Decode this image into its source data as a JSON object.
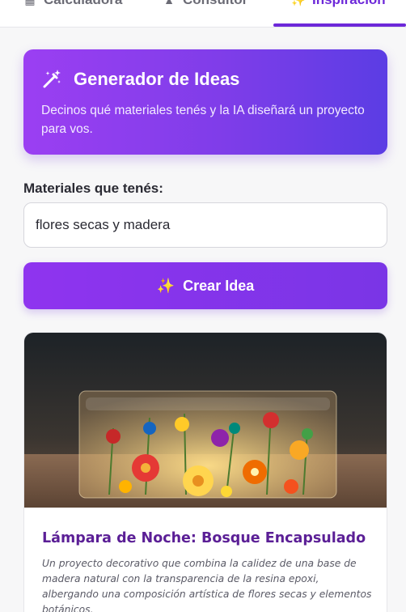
{
  "tabs": [
    {
      "label": "Calculadora",
      "icon": "calculator-icon"
    },
    {
      "label": "Consultor",
      "icon": "flask-icon"
    },
    {
      "label": "Inspiración",
      "icon": "sparkles-icon",
      "active": true
    }
  ],
  "hero": {
    "title": "Generador de Ideas",
    "description": "Decinos qué materiales tenés y la IA diseñará un proyecto para vos."
  },
  "materials": {
    "label": "Materiales que tenés:",
    "value": "flores secas y madera"
  },
  "create_button": {
    "label": "Crear Idea"
  },
  "idea_card": {
    "title": "Lámpara de Noche: Bosque Encapsulado",
    "description": "Un proyecto decorativo que combina la calidez de una base de madera natural con la transparencia de la resina epoxi, albergando una composición artística de flores secas y elementos botánicos."
  },
  "colors": {
    "accent": "#6d28d9",
    "gradient_start": "#9b3ff2",
    "gradient_end": "#5b3de4"
  }
}
